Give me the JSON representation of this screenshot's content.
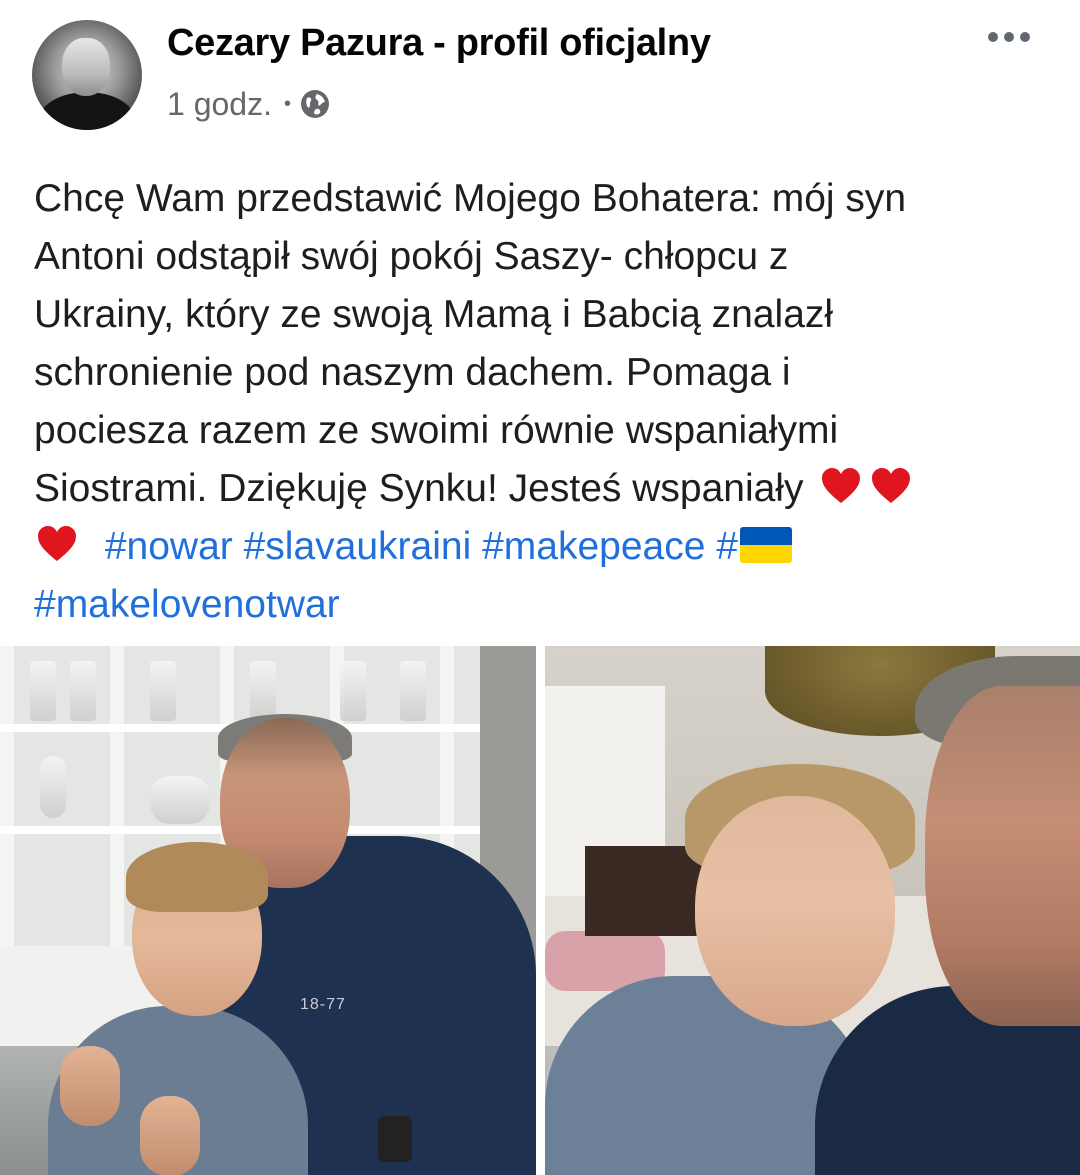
{
  "post": {
    "author": "Cezary Pazura - profil oficjalny",
    "time": "1 godz.",
    "separator": "•",
    "audience_icon": "globe-icon",
    "menu_icon": "more-options-icon",
    "text_lines": [
      "Chcę Wam przedstawić Mojego Bohatera: mój syn",
      "Antoni odstąpił swój pokój Saszy- chłopcu z",
      "Ukrainy, który ze swoją Mamą i Babcią znalazł",
      "schronienie pod naszym dachem. Pomaga i",
      "pociesza razem ze swoimi równie wspaniałymi",
      "Siostrami. Dziękuję Synku! Jesteś wspaniały"
    ],
    "hashtags": [
      "#nowar",
      "#slavaukraini",
      "#makepeace",
      "#",
      "#makelovenotwar"
    ],
    "emoji": {
      "heart": "heart-emoji",
      "flag": "ukraine-flag-emoji"
    },
    "photos": [
      {
        "label": "photo-left",
        "print": "18-77"
      },
      {
        "label": "photo-right"
      }
    ],
    "colors": {
      "hashtag": "#216fdb",
      "meta": "#65676b",
      "heart": "#e0161e",
      "flag_blue": "#0057b7",
      "flag_yellow": "#ffd700"
    }
  }
}
